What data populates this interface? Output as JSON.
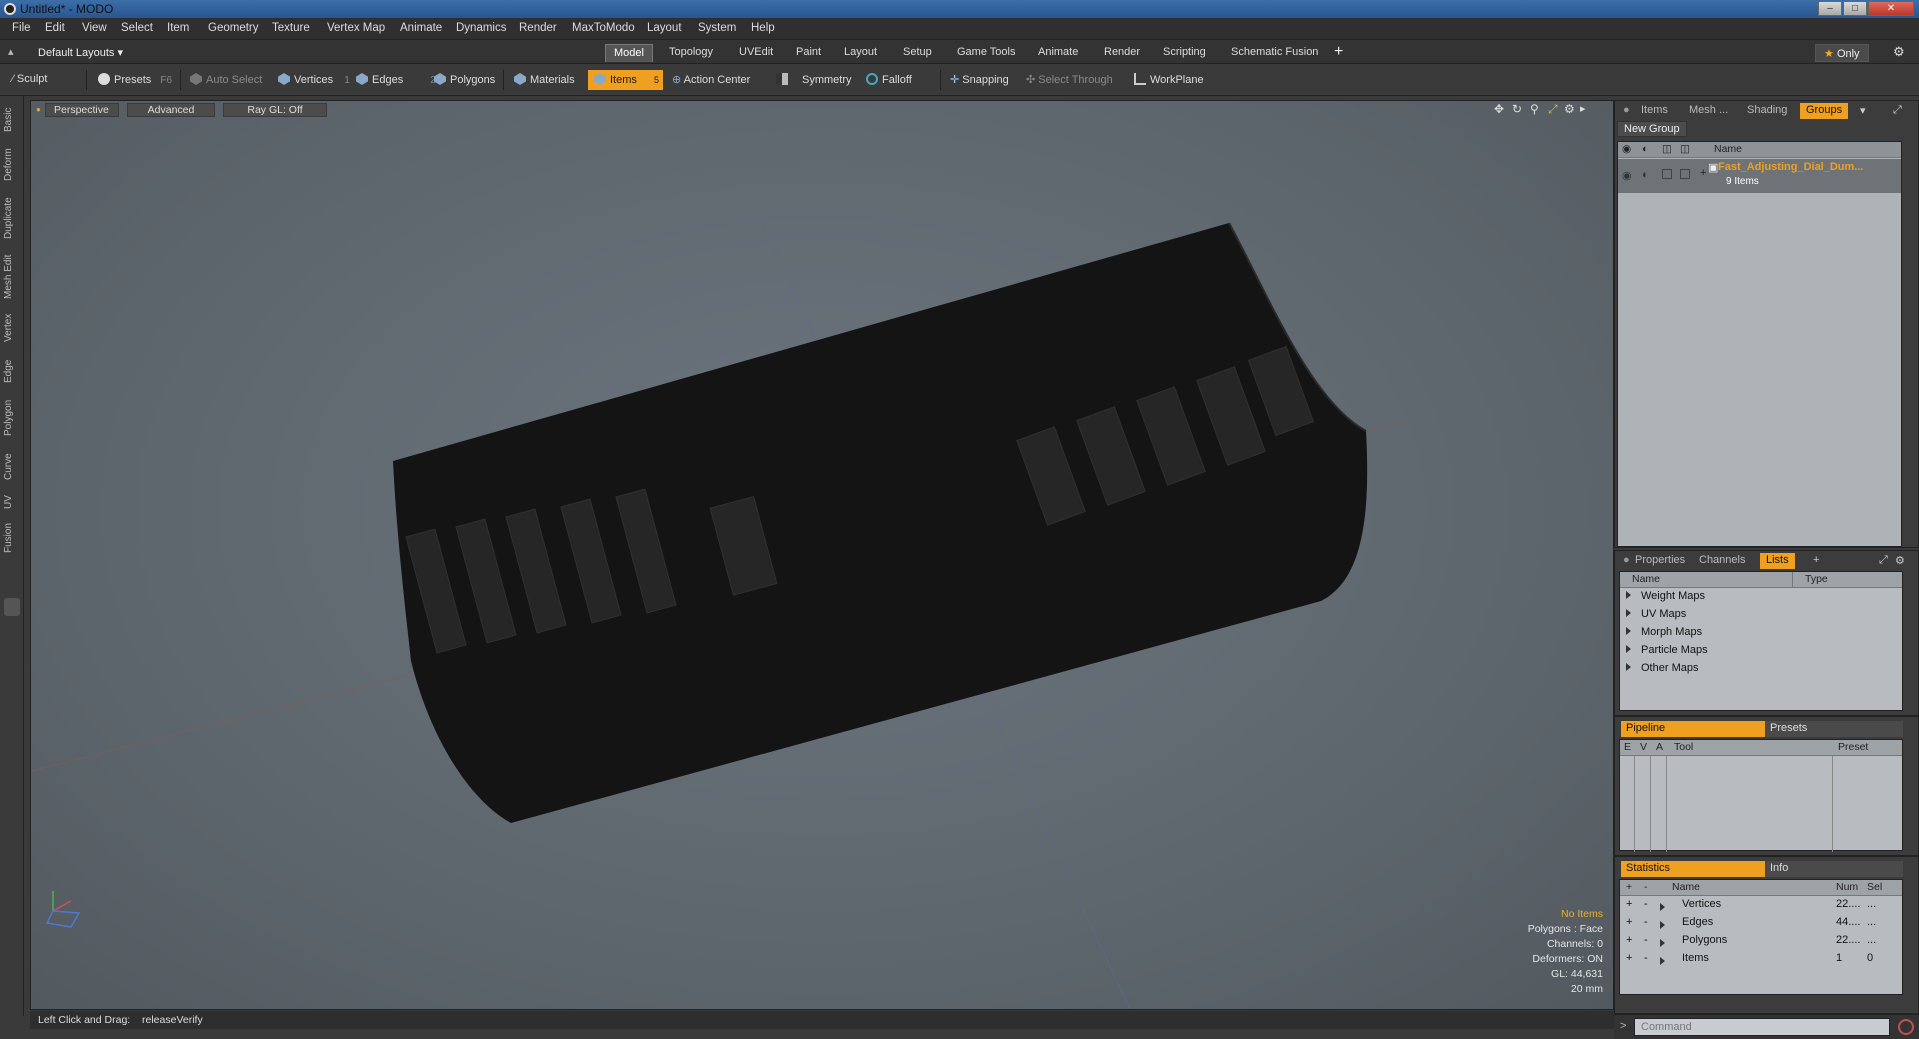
{
  "window": {
    "title": "Untitled* - MODO"
  },
  "menu": [
    "File",
    "Edit",
    "View",
    "Select",
    "Item",
    "Geometry",
    "Texture",
    "Vertex Map",
    "Animate",
    "Dynamics",
    "Render",
    "MaxToModo",
    "Layout",
    "System",
    "Help"
  ],
  "layouts": {
    "label": "Default Layouts"
  },
  "layout_tabs": [
    "Model",
    "Topology",
    "UVEdit",
    "Paint",
    "Layout",
    "Setup",
    "Game Tools",
    "Animate",
    "Render",
    "Scripting",
    "Schematic Fusion"
  ],
  "active_layout_tab": "Model",
  "only_label": "Only",
  "toolbar": {
    "sculpt": "Sculpt",
    "presets": "Presets",
    "presets_key": "F6",
    "auto_select": "Auto Select",
    "vertices": "Vertices",
    "vertices_key": "1",
    "edges": "Edges",
    "edges_key": "2",
    "polygons": "Polygons",
    "materials": "Materials",
    "items": "Items",
    "items_key": "5",
    "action_center": "Action Center",
    "symmetry": "Symmetry",
    "falloff": "Falloff",
    "snapping": "Snapping",
    "select_through": "Select Through",
    "workplane": "WorkPlane"
  },
  "left_tabs": [
    "Basic",
    "Deform",
    "Duplicate",
    "Mesh Edit",
    "Vertex",
    "Edge",
    "Polygon",
    "Curve",
    "UV",
    "Fusion"
  ],
  "viewport": {
    "perspective": "Perspective",
    "advanced": "Advanced",
    "raygl": "Ray GL: Off",
    "stats": {
      "items": "No Items",
      "polygons": "Polygons : Face",
      "channels": "Channels: 0",
      "deformers": "Deformers: ON",
      "gl": "GL: 44,631",
      "scale": "20 mm"
    }
  },
  "status": {
    "label": "Left Click and Drag:",
    "value": "releaseVerify"
  },
  "groups_panel": {
    "tabs": [
      "Items",
      "Mesh ...",
      "Shading",
      "Groups"
    ],
    "active_tab": "Groups",
    "new_group": "New Group",
    "name_header": "Name",
    "group_name": "Fast_Adjusting_Dial_Dum...",
    "group_count": "9 Items"
  },
  "lists_panel": {
    "tabs": [
      "Properties",
      "Channels",
      "Lists"
    ],
    "active_tab": "Lists",
    "name_header": "Name",
    "type_header": "Type",
    "rows": [
      "Weight Maps",
      "UV Maps",
      "Morph Maps",
      "Particle Maps",
      "Other Maps"
    ]
  },
  "pipeline_panel": {
    "tab_pipeline": "Pipeline",
    "tab_presets": "Presets",
    "cols": [
      "E",
      "V",
      "A",
      "Tool",
      "Preset"
    ]
  },
  "stats_panel": {
    "tab_statistics": "Statistics",
    "tab_info": "Info",
    "cols": [
      "+",
      "-",
      "Name",
      "Num",
      "Sel"
    ],
    "rows": [
      {
        "name": "Vertices",
        "num": "22....",
        "sel": "..."
      },
      {
        "name": "Edges",
        "num": "44....",
        "sel": "..."
      },
      {
        "name": "Polygons",
        "num": "22....",
        "sel": "..."
      },
      {
        "name": "Items",
        "num": "1",
        "sel": "0"
      }
    ]
  },
  "command": {
    "placeholder": "Command"
  }
}
